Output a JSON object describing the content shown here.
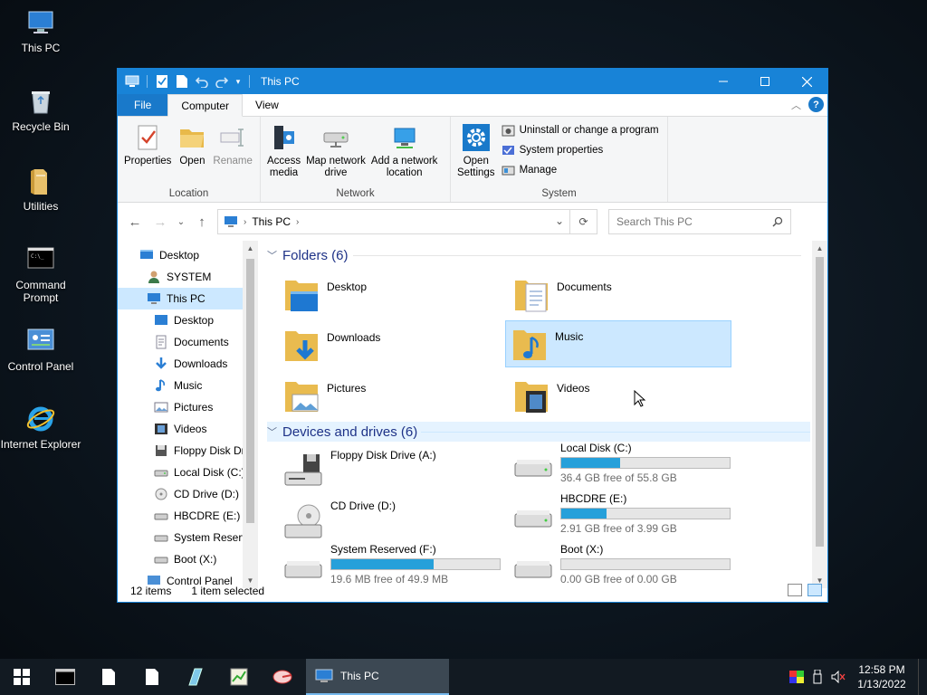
{
  "desktop": {
    "icons": [
      {
        "label": "This PC",
        "icon": "computer-icon"
      },
      {
        "label": "Recycle Bin",
        "icon": "recycle-bin-icon"
      },
      {
        "label": "Utilities",
        "icon": "folder-icon"
      },
      {
        "label": "Command Prompt",
        "icon": "terminal-icon"
      },
      {
        "label": "Control Panel",
        "icon": "control-panel-icon"
      },
      {
        "label": "Internet Explorer",
        "icon": "ie-icon"
      }
    ]
  },
  "window": {
    "title": "This PC",
    "tabs": {
      "file": "File",
      "computer": "Computer",
      "view": "View"
    },
    "ribbon": {
      "location": {
        "label": "Location",
        "properties": "Properties",
        "open": "Open",
        "rename": "Rename"
      },
      "network": {
        "label": "Network",
        "access_media_1": "Access",
        "access_media_2": "media",
        "map_drive_1": "Map network",
        "map_drive_2": "drive",
        "add_location_1": "Add a network",
        "add_location_2": "location"
      },
      "system": {
        "label": "System",
        "open_settings_1": "Open",
        "open_settings_2": "Settings",
        "uninstall": "Uninstall or change a program",
        "system_properties": "System properties",
        "manage": "Manage"
      }
    },
    "address": {
      "crumb": "This PC",
      "search_placeholder": "Search This PC"
    },
    "nav": [
      {
        "label": "Desktop",
        "level": 0,
        "icon": "desktop-icon"
      },
      {
        "label": "SYSTEM",
        "level": 1,
        "icon": "user-icon"
      },
      {
        "label": "This PC",
        "level": 1,
        "icon": "computer-icon",
        "selected": true
      },
      {
        "label": "Desktop",
        "level": 2,
        "icon": "desktop-icon"
      },
      {
        "label": "Documents",
        "level": 2,
        "icon": "documents-icon"
      },
      {
        "label": "Downloads",
        "level": 2,
        "icon": "downloads-icon"
      },
      {
        "label": "Music",
        "level": 2,
        "icon": "music-icon"
      },
      {
        "label": "Pictures",
        "level": 2,
        "icon": "pictures-icon"
      },
      {
        "label": "Videos",
        "level": 2,
        "icon": "videos-icon"
      },
      {
        "label": "Floppy Disk Dri",
        "level": 2,
        "icon": "floppy-icon"
      },
      {
        "label": "Local Disk (C:)",
        "level": 2,
        "icon": "drive-icon"
      },
      {
        "label": "CD Drive (D:)",
        "level": 2,
        "icon": "cd-icon"
      },
      {
        "label": "HBCDRE (E:)",
        "level": 2,
        "icon": "drive-icon"
      },
      {
        "label": "System Reserve",
        "level": 2,
        "icon": "drive-icon"
      },
      {
        "label": "Boot (X:)",
        "level": 2,
        "icon": "drive-icon"
      },
      {
        "label": "Control Panel",
        "level": 1,
        "icon": "control-panel-icon"
      }
    ],
    "folders_header": "Folders (6)",
    "folders": [
      {
        "name": "Desktop",
        "icon": "desktop-folder-icon"
      },
      {
        "name": "Documents",
        "icon": "documents-folder-icon"
      },
      {
        "name": "Downloads",
        "icon": "downloads-folder-icon"
      },
      {
        "name": "Music",
        "icon": "music-folder-icon",
        "selected": true
      },
      {
        "name": "Pictures",
        "icon": "pictures-folder-icon"
      },
      {
        "name": "Videos",
        "icon": "videos-folder-icon"
      }
    ],
    "drives_header": "Devices and drives (6)",
    "drives": [
      {
        "name": "Floppy Disk Drive (A:)",
        "icon": "floppy-icon"
      },
      {
        "name": "Local Disk (C:)",
        "icon": "drive-icon",
        "free": "36.4 GB free of 55.8 GB",
        "used_fraction": 0.35
      },
      {
        "name": "CD Drive (D:)",
        "icon": "cd-icon"
      },
      {
        "name": "HBCDRE (E:)",
        "icon": "drive-icon",
        "free": "2.91 GB free of 3.99 GB",
        "used_fraction": 0.27
      },
      {
        "name": "System Reserved (F:)",
        "icon": "drive-icon",
        "free": "19.6 MB free of 49.9 MB",
        "used_fraction": 0.61
      },
      {
        "name": "Boot (X:)",
        "icon": "drive-icon",
        "free": "0.00 GB free of 0.00 GB",
        "used_fraction": 0.0
      }
    ],
    "status": {
      "items": "12 items",
      "selected": "1 item selected"
    }
  },
  "taskbar": {
    "active_label": "This PC",
    "time": "12:58 PM",
    "date": "1/13/2022"
  }
}
